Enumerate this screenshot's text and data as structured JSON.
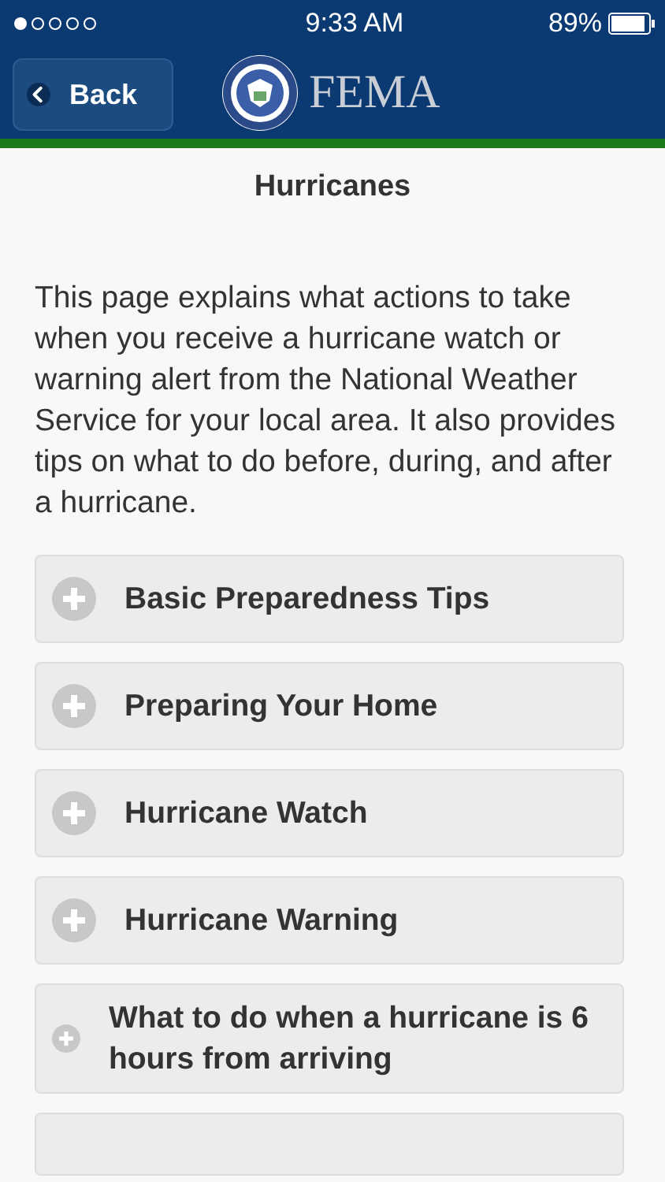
{
  "status_bar": {
    "time": "9:33 AM",
    "battery": "89%"
  },
  "header": {
    "back": "Back",
    "logo_text": "FEMA"
  },
  "title": "Hurricanes",
  "intro": "This page explains what actions to take when you receive a hurricane watch or warning alert from the National Weather Service for your local area. It also provides tips on what to do before, during, and after a hurricane.",
  "sections": [
    {
      "label": "Basic Preparedness Tips",
      "expanded": false
    },
    {
      "label": "Preparing Your Home",
      "expanded": false
    },
    {
      "label": "Hurricane Watch",
      "expanded": false
    },
    {
      "label": "Hurricane Warning",
      "expanded": false
    },
    {
      "label": "What to do when a hurricane is 6 hours from arriving",
      "expanded": false
    }
  ]
}
